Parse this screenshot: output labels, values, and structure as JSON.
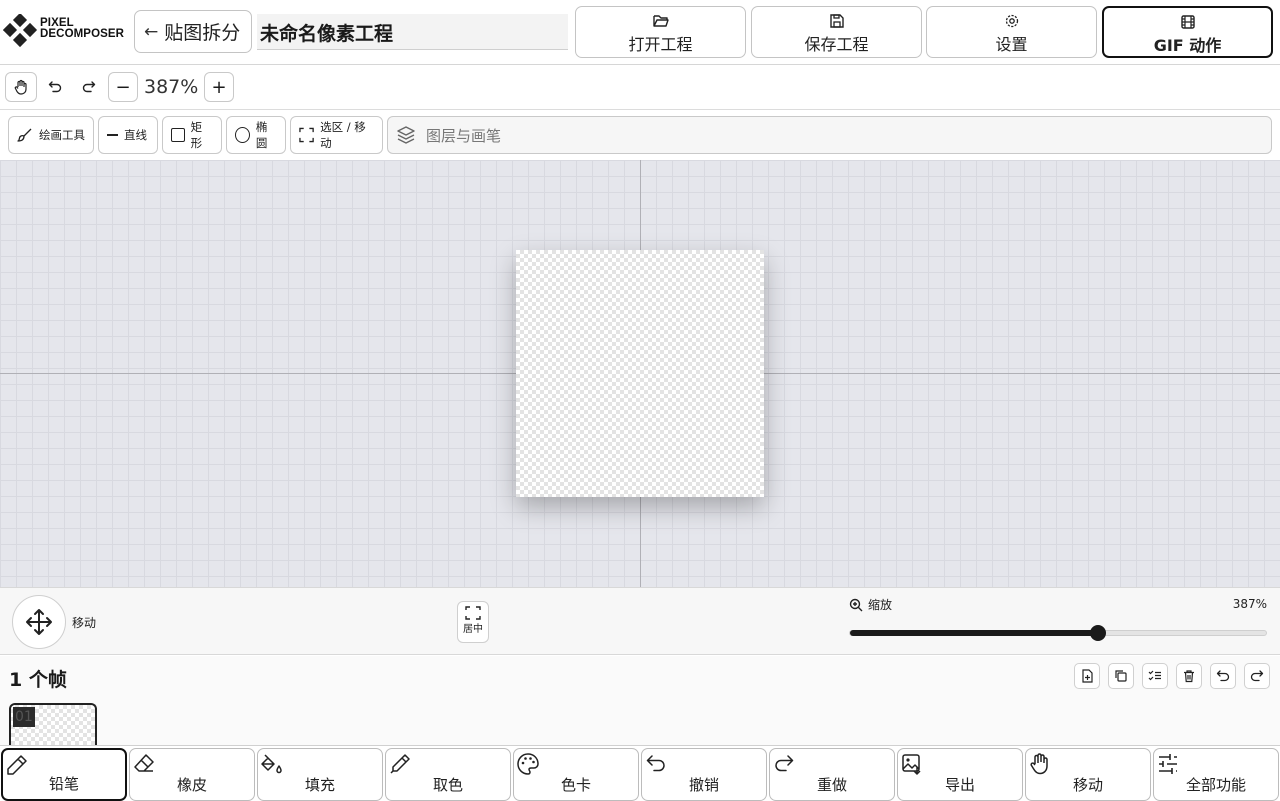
{
  "header": {
    "logo_line1": "PIXEL",
    "logo_line2": "DECOMPOSER",
    "back_label": "贴图拆分",
    "project_name": "未命名像素工程",
    "buttons": [
      {
        "label": "打开工程",
        "icon": "folder-open-icon"
      },
      {
        "label": "保存工程",
        "icon": "save-icon"
      },
      {
        "label": "设置",
        "icon": "gear-icon"
      },
      {
        "label": "GIF 动作",
        "icon": "film-icon",
        "active": true
      }
    ]
  },
  "toolbar": {
    "zoom_level": "387%"
  },
  "tools": {
    "draw": "绘画工具",
    "line": "直线",
    "rect": "矩形",
    "ellipse": "椭圆",
    "select": "选区 / 移动",
    "layers": "图层与画笔"
  },
  "controls": {
    "move_label": "移动",
    "center_label": "居中",
    "zoom_title": "缩放",
    "zoom_value": "387%",
    "zoom_fraction": 0.595
  },
  "frames": {
    "title": "1 个帧",
    "items": [
      {
        "number": "01"
      }
    ]
  },
  "bottom_tools": [
    {
      "label": "铅笔",
      "icon": "pencil-icon",
      "active": true
    },
    {
      "label": "橡皮",
      "icon": "eraser-icon"
    },
    {
      "label": "填充",
      "icon": "paint-bucket-icon"
    },
    {
      "label": "取色",
      "icon": "eyedropper-icon"
    },
    {
      "label": "色卡",
      "icon": "palette-icon"
    },
    {
      "label": "撤销",
      "icon": "undo-icon"
    },
    {
      "label": "重做",
      "icon": "redo-icon"
    },
    {
      "label": "导出",
      "icon": "image-export-icon"
    },
    {
      "label": "移动",
      "icon": "hand-icon"
    },
    {
      "label": "全部功能",
      "icon": "sliders-icon"
    }
  ],
  "colors": {
    "canvas_bg": "#e5e6ec",
    "accent": "#1a1a1a"
  }
}
